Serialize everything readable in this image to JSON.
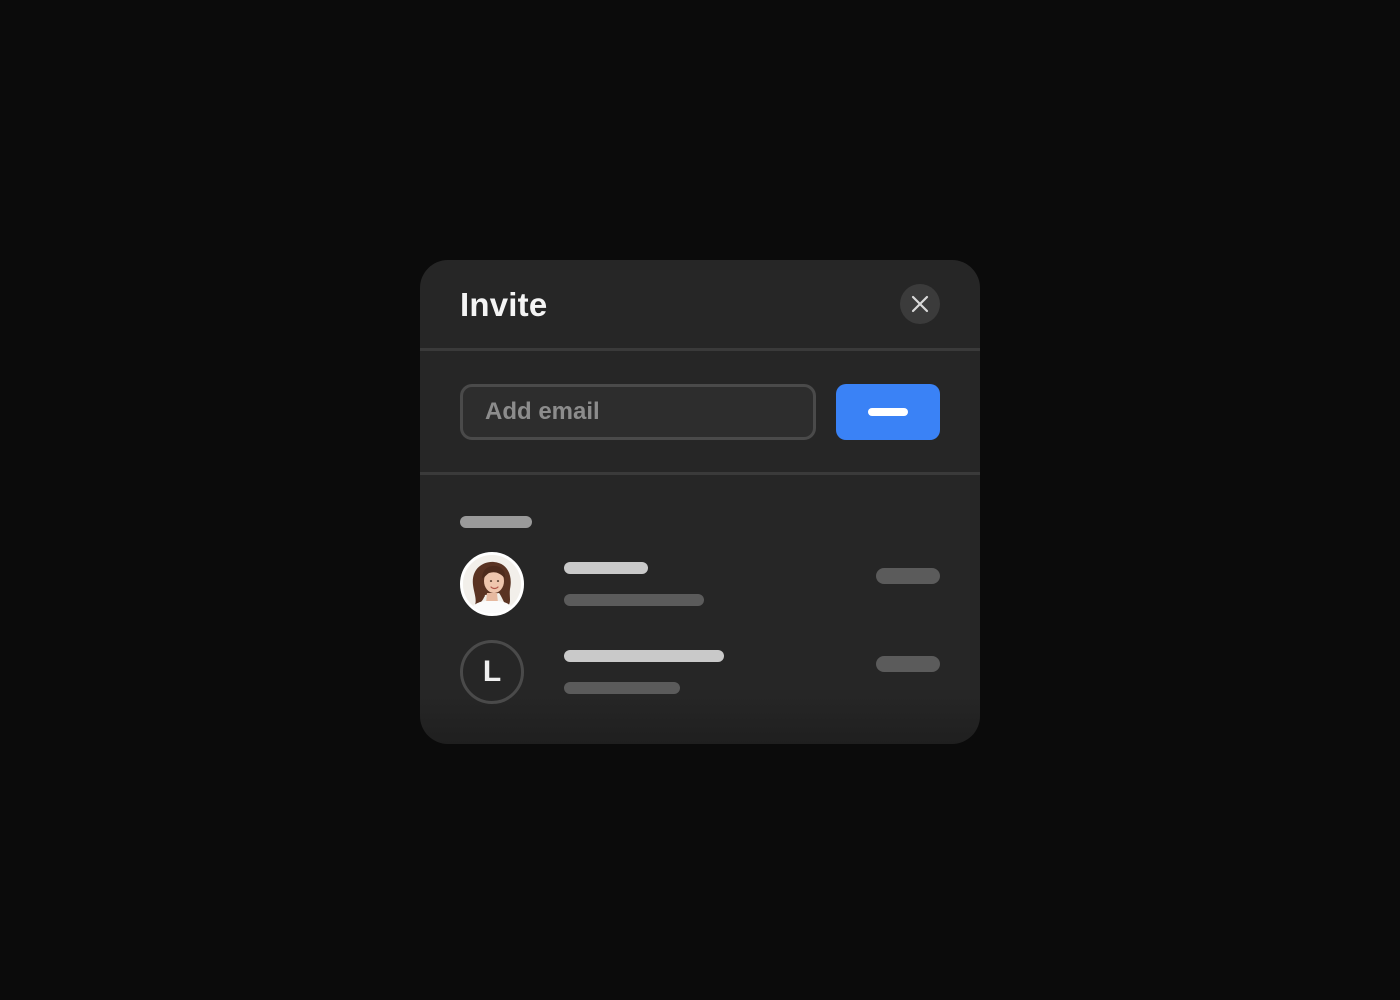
{
  "dialog": {
    "title": "Invite",
    "close_icon": "close-icon"
  },
  "invite": {
    "email_placeholder": "Add email",
    "email_value": "",
    "submit_icon": "minus-bar-icon",
    "accent_color": "#3a82f6"
  },
  "members": [
    {
      "avatar_type": "photo",
      "avatar_icon": "woman-portrait-photo"
    },
    {
      "avatar_type": "initial",
      "initial": "L"
    }
  ],
  "colors": {
    "background": "#0b0b0b",
    "dialog": "#262626",
    "divider": "#3a3a3a"
  }
}
